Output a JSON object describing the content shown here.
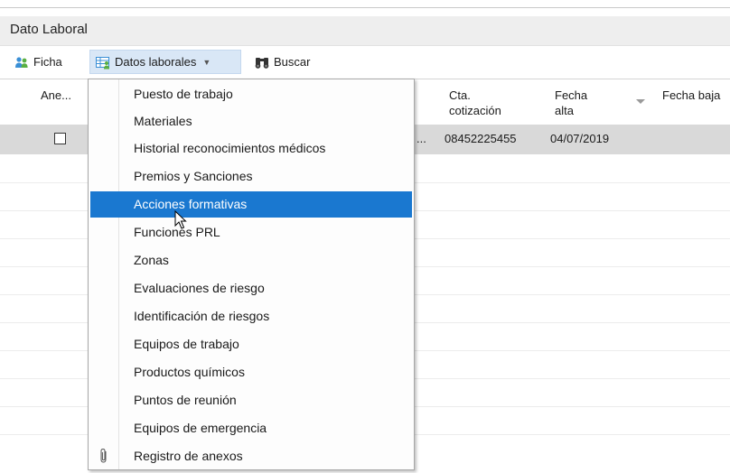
{
  "section": {
    "title": "Dato Laboral"
  },
  "toolbar": {
    "ficha_label": "Ficha",
    "datos_label": "Datos laborales",
    "buscar_label": "Buscar"
  },
  "grid": {
    "headers": {
      "anexos": "Ane...",
      "cta": "Cta.",
      "cta2": "cotización",
      "fecha_alta": "Fecha",
      "fecha_alta2": "alta",
      "fecha_baja": "Fecha baja"
    },
    "row": {
      "truncated": "...",
      "cta_value": "08452225455",
      "fecha_alta_value": "04/07/2019"
    }
  },
  "menu": {
    "items": [
      "Puesto de trabajo",
      "Materiales",
      "Historial reconocimientos médicos",
      "Premios y Sanciones",
      "Acciones formativas",
      "Funciones PRL",
      "Zonas",
      "Evaluaciones de riesgo",
      "Identificación de riesgos",
      "Equipos de trabajo",
      "Productos químicos",
      "Puntos de reunión",
      "Equipos de emergencia",
      "Registro de anexos"
    ],
    "highlighted_index": 4
  },
  "colors": {
    "highlight": "#1a78d0",
    "toolbar_active": "#d9e7f6",
    "selected_row": "#d9d9d9"
  },
  "icons": {
    "ficha": "people-icon",
    "datos": "people-grid-icon",
    "buscar": "binoculars-icon",
    "registro": "paperclip-icon"
  }
}
